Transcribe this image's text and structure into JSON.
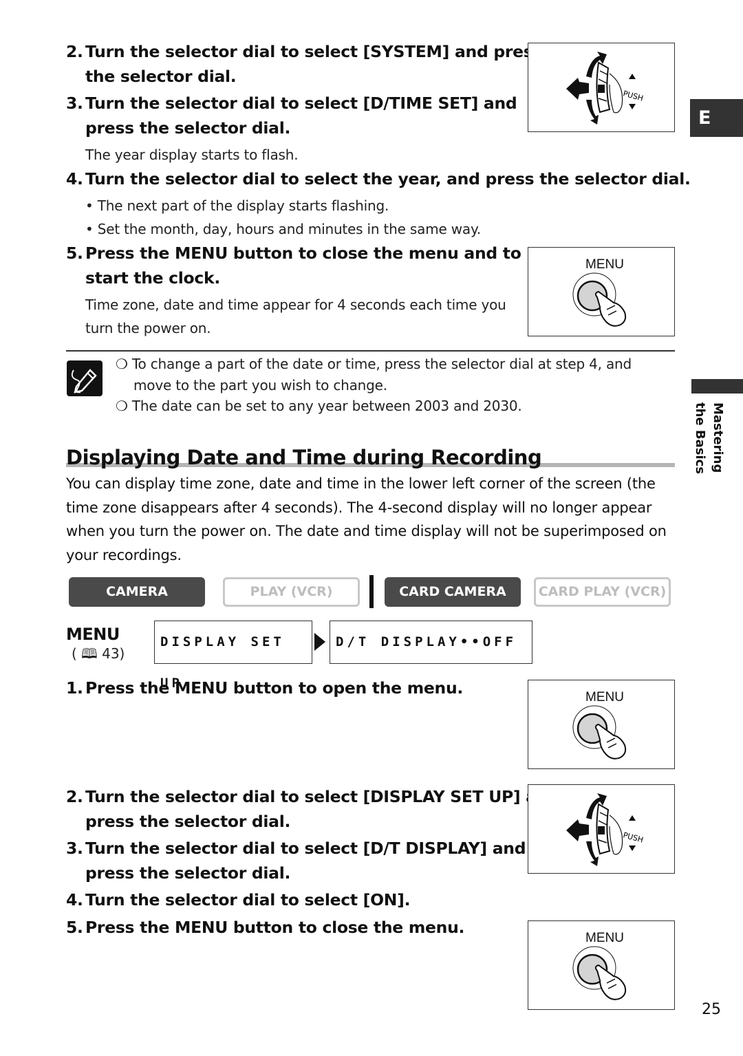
{
  "top_steps": [
    {
      "num": "2.",
      "lines": [
        "Turn the selector dial to select [SYSTEM] and press",
        "the selector dial."
      ]
    },
    {
      "num": "3.",
      "lines": [
        "Turn the selector dial to select [D/TIME SET] and",
        "press the selector dial."
      ]
    },
    {
      "num": "4.",
      "lines": [
        "Turn the selector dial to select the year, and press the selector dial."
      ]
    },
    {
      "num": "5.",
      "lines": [
        "Press the MENU button to close the menu and to",
        "start the clock."
      ]
    }
  ],
  "step3_note": "The year display starts to flash.",
  "step4_bullets": [
    "• The next part of the display starts flashing.",
    "• Set the month, day, hours and minutes in the same way."
  ],
  "step5_note": [
    "Time zone, date and time appear for 4 seconds each time you",
    "turn the power on."
  ],
  "notes": [
    "❍ To change a part of the date or time, press the selector dial at step 4, and",
    "move to the part you wish to change.",
    "❍ The date can be set to any year between 2003 and 2030."
  ],
  "side_tab": {
    "letter": "E",
    "section_line1": "Mastering",
    "section_line2": "the Basics"
  },
  "section": {
    "title": "Displaying Date and Time during Recording",
    "intro": "You can display time zone, date and time in the lower left corner of the screen (the time zone disappears after 4 seconds). The 4-second display will no longer appear when you turn the power on. The date and time display will not be superimposed on your recordings."
  },
  "modes": [
    {
      "label": "CAMERA",
      "active": true
    },
    {
      "label": "PLAY (VCR)",
      "active": false
    },
    {
      "label": "CARD CAMERA",
      "active": true
    },
    {
      "label": "CARD PLAY (VCR)",
      "active": false
    }
  ],
  "menu": {
    "logo": "MENU",
    "ref": "( 🕮 43)",
    "path1": "DISPLAY SET UP",
    "path2": "D/T DISPLAY••OFF"
  },
  "bottom_steps": [
    {
      "num": "1.",
      "lines": [
        "Press the MENU button to open the menu."
      ]
    },
    {
      "num": "2.",
      "lines": [
        "Turn the selector dial to select [DISPLAY SET UP] and",
        "press the selector dial."
      ]
    },
    {
      "num": "3.",
      "lines": [
        "Turn the selector dial to select [D/T DISPLAY] and",
        "press the selector dial."
      ]
    },
    {
      "num": "4.",
      "lines": [
        "Turn the selector dial to select [ON]."
      ]
    },
    {
      "num": "5.",
      "lines": [
        "Press the MENU button to close the menu."
      ]
    }
  ],
  "figures": {
    "menu_label": "MENU",
    "push_label": "PUSH"
  },
  "page_number": "25"
}
